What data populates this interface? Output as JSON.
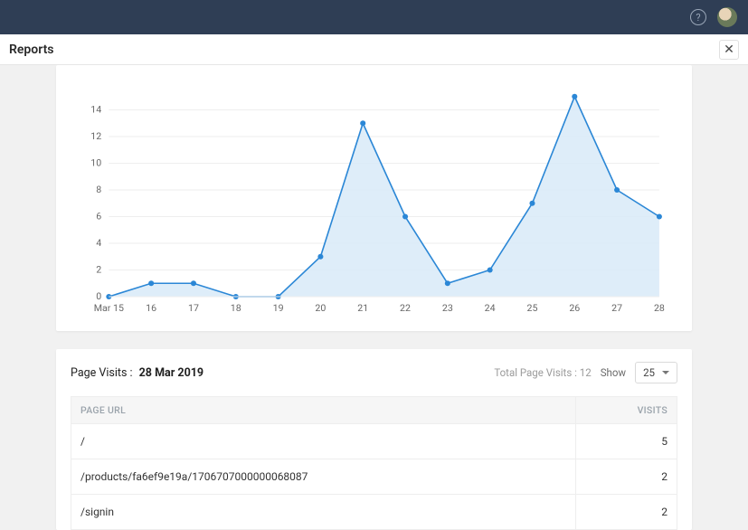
{
  "topbar": {
    "help_tooltip": "Help"
  },
  "header": {
    "title": "Reports"
  },
  "chart_data": {
    "type": "area",
    "categories": [
      "Mar 15",
      "16",
      "17",
      "18",
      "19",
      "20",
      "21",
      "22",
      "23",
      "24",
      "25",
      "26",
      "27",
      "28"
    ],
    "values": [
      0,
      1,
      1,
      0,
      0,
      3,
      13,
      6,
      1,
      2,
      7,
      15,
      8,
      6
    ],
    "ylim": [
      0,
      16
    ],
    "yticks": [
      0,
      2,
      4,
      6,
      8,
      10,
      12,
      14
    ],
    "xlabel": "",
    "ylabel": "",
    "title": ""
  },
  "page_visits": {
    "label": "Page Visits :",
    "date": "28 Mar 2019",
    "total_label": "Total Page Visits :",
    "total_value": 12,
    "show_label": "Show",
    "page_size": "25",
    "columns": {
      "url": "PAGE URL",
      "visits": "VISITS"
    },
    "rows": [
      {
        "url": "/",
        "visits": 5
      },
      {
        "url": "/products/fa6ef9e19a/1706707000000068087",
        "visits": 2
      },
      {
        "url": "/signin",
        "visits": 2
      }
    ]
  }
}
